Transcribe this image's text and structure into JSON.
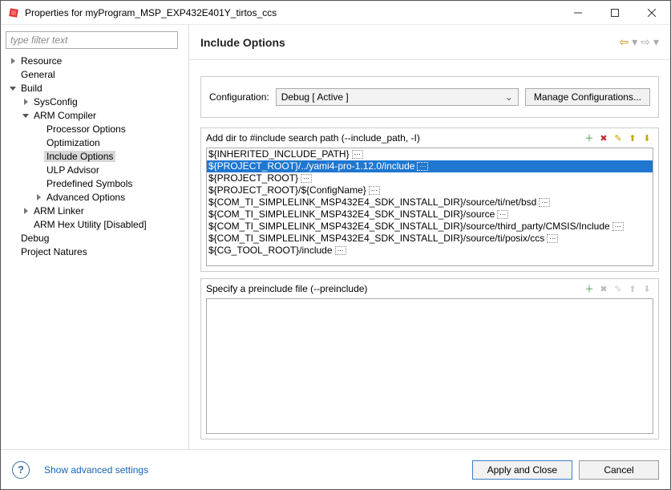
{
  "window": {
    "title": "Properties for myProgram_MSP_EXP432E401Y_tirtos_ccs"
  },
  "sidebar": {
    "filter_placeholder": "type filter text",
    "items": [
      {
        "label": "Resource",
        "state": "closed",
        "indent": 0
      },
      {
        "label": "General",
        "state": "leaf",
        "indent": 0
      },
      {
        "label": "Build",
        "state": "open",
        "indent": 0
      },
      {
        "label": "SysConfig",
        "state": "closed",
        "indent": 1
      },
      {
        "label": "ARM Compiler",
        "state": "open",
        "indent": 1
      },
      {
        "label": "Processor Options",
        "state": "leaf",
        "indent": 2
      },
      {
        "label": "Optimization",
        "state": "leaf",
        "indent": 2
      },
      {
        "label": "Include Options",
        "state": "leaf",
        "indent": 2,
        "selected": true
      },
      {
        "label": "ULP Advisor",
        "state": "leaf",
        "indent": 2
      },
      {
        "label": "Predefined Symbols",
        "state": "leaf",
        "indent": 2
      },
      {
        "label": "Advanced Options",
        "state": "closed",
        "indent": 2
      },
      {
        "label": "ARM Linker",
        "state": "closed",
        "indent": 1
      },
      {
        "label": "ARM Hex Utility  [Disabled]",
        "state": "leaf",
        "indent": 1
      },
      {
        "label": "Debug",
        "state": "leaf",
        "indent": 0
      },
      {
        "label": "Project Natures",
        "state": "leaf",
        "indent": 0
      }
    ]
  },
  "main": {
    "heading": "Include Options",
    "config_label": "Configuration:",
    "config_value": "Debug  [ Active ]",
    "manage_label": "Manage Configurations...",
    "include_section_title": "Add dir to #include search path (--include_path, -I)",
    "include_paths": [
      {
        "text": "${INHERITED_INCLUDE_PATH}",
        "ellipsis": true,
        "selected": false
      },
      {
        "text": "${PROJECT_ROOT}/../yami4-pro-1.12.0/include",
        "ellipsis": true,
        "selected": true
      },
      {
        "text": "${PROJECT_ROOT}",
        "ellipsis": true,
        "selected": false
      },
      {
        "text": "${PROJECT_ROOT}/${ConfigName}",
        "ellipsis": true,
        "selected": false
      },
      {
        "text": "${COM_TI_SIMPLELINK_MSP432E4_SDK_INSTALL_DIR}/source/ti/net/bsd",
        "ellipsis": true,
        "selected": false
      },
      {
        "text": "${COM_TI_SIMPLELINK_MSP432E4_SDK_INSTALL_DIR}/source",
        "ellipsis": true,
        "selected": false
      },
      {
        "text": "${COM_TI_SIMPLELINK_MSP432E4_SDK_INSTALL_DIR}/source/third_party/CMSIS/Include",
        "ellipsis": true,
        "selected": false
      },
      {
        "text": "${COM_TI_SIMPLELINK_MSP432E4_SDK_INSTALL_DIR}/source/ti/posix/ccs",
        "ellipsis": true,
        "selected": false
      },
      {
        "text": "${CG_TOOL_ROOT}/include",
        "ellipsis": true,
        "selected": false
      }
    ],
    "preinclude_section_title": "Specify a preinclude file (--preinclude)",
    "preinclude_files": []
  },
  "footer": {
    "advanced_link": "Show advanced settings",
    "apply_label": "Apply and Close",
    "cancel_label": "Cancel"
  },
  "icons": {
    "add_glyph": "＋",
    "del_glyph": "✖",
    "edit_glyph": "✎",
    "up_glyph": "⬆",
    "down_glyph": "⬇"
  }
}
